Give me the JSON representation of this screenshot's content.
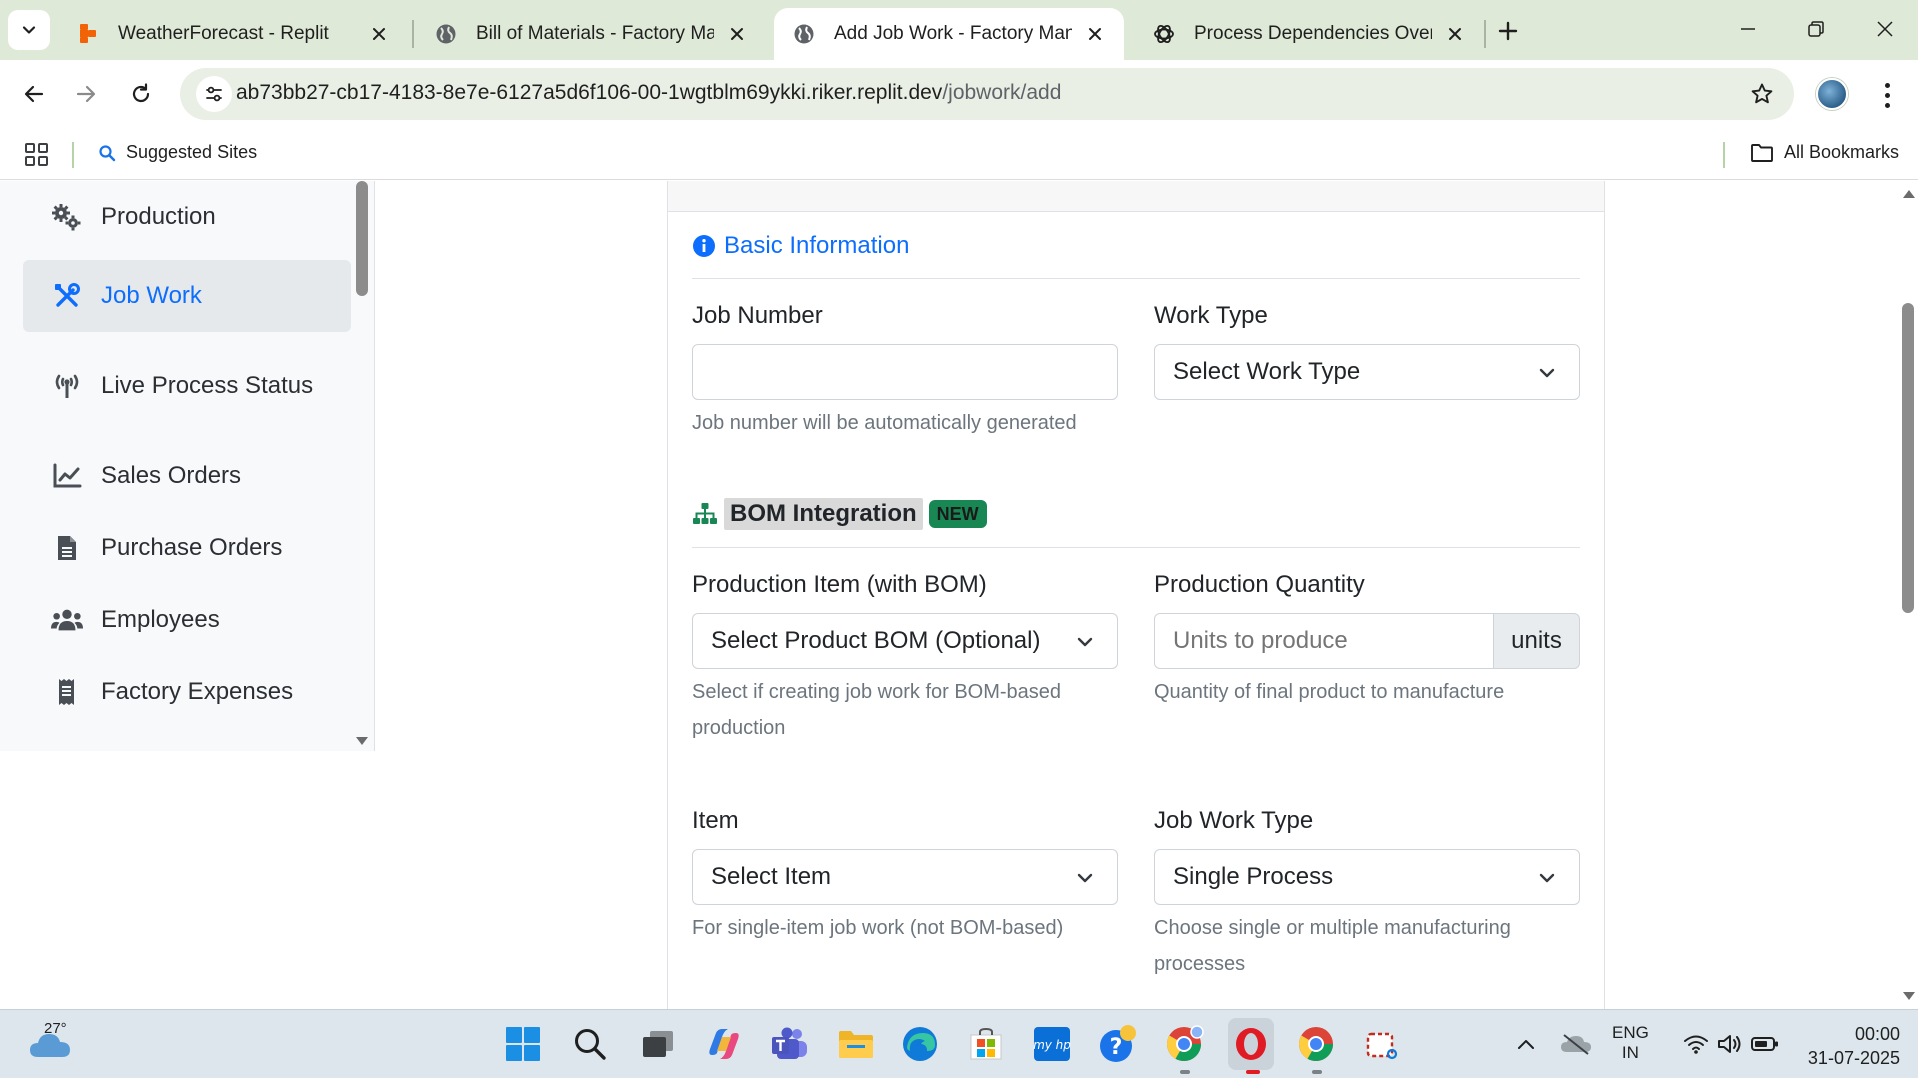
{
  "browser": {
    "tabs": [
      {
        "title": "WeatherForecast - Replit",
        "active": false,
        "favicon": "replit-icon"
      },
      {
        "title": "Bill of Materials - Factory Manag",
        "active": false,
        "favicon": "globe-icon"
      },
      {
        "title": "Add Job Work - Factory Manag",
        "active": true,
        "favicon": "globe-icon"
      },
      {
        "title": "Process Dependencies Overview",
        "active": false,
        "favicon": "chatgpt-icon"
      }
    ],
    "url_host": "ab73bb27-cb17-4183-8e7e-6127a5d6f106-00-1wgtblm69ykki.riker.replit.dev",
    "url_path": "/jobwork/add",
    "bookmarks": {
      "suggested": "Suggested Sites",
      "all": "All Bookmarks"
    }
  },
  "sidebar": {
    "items": [
      {
        "label": "Production",
        "icon": "gears-icon",
        "active": false
      },
      {
        "label": "Job Work",
        "icon": "tools-icon",
        "active": true
      },
      {
        "label": "Live Process Status",
        "icon": "broadcast-tower-icon",
        "active": false
      },
      {
        "label": "Sales Orders",
        "icon": "chart-line-icon",
        "active": false
      },
      {
        "label": "Purchase Orders",
        "icon": "file-alt-icon",
        "active": false
      },
      {
        "label": "Employees",
        "icon": "users-icon",
        "active": false
      },
      {
        "label": "Factory Expenses",
        "icon": "receipt-icon",
        "active": false
      }
    ]
  },
  "form": {
    "basic_info_title": "Basic Information",
    "job_number_label": "Job Number",
    "job_number_value": "",
    "job_number_help": "Job number will be automatically generated",
    "work_type_label": "Work Type",
    "work_type_value": "Select Work Type",
    "bom_title": "BOM Integration",
    "bom_badge": "NEW",
    "production_item_label": "Production Item (with BOM)",
    "production_item_value": "Select Product BOM (Optional)",
    "production_item_help_1": "Select if creating job work for BOM-based",
    "production_item_help_2": "production",
    "production_qty_label": "Production Quantity",
    "production_qty_placeholder": "Units to produce",
    "production_qty_unit": "units",
    "production_qty_help": "Quantity of final product to manufacture",
    "item_label": "Item",
    "item_value": "Select Item",
    "item_help": "For single-item job work (not BOM-based)",
    "job_work_type_label": "Job Work Type",
    "job_work_type_value": "Single Process",
    "job_work_type_help_1": "Choose single or multiple manufacturing",
    "job_work_type_help_2": "processes"
  },
  "taskbar": {
    "weather_temp": "27°",
    "lang_1": "ENG",
    "lang_2": "IN",
    "time": "00:00",
    "date": "31-07-2025"
  },
  "colors": {
    "accent": "#0d6efd",
    "badge": "#198754",
    "bom_icon": "#198754",
    "chrome_bg": "#dfe9d7"
  }
}
